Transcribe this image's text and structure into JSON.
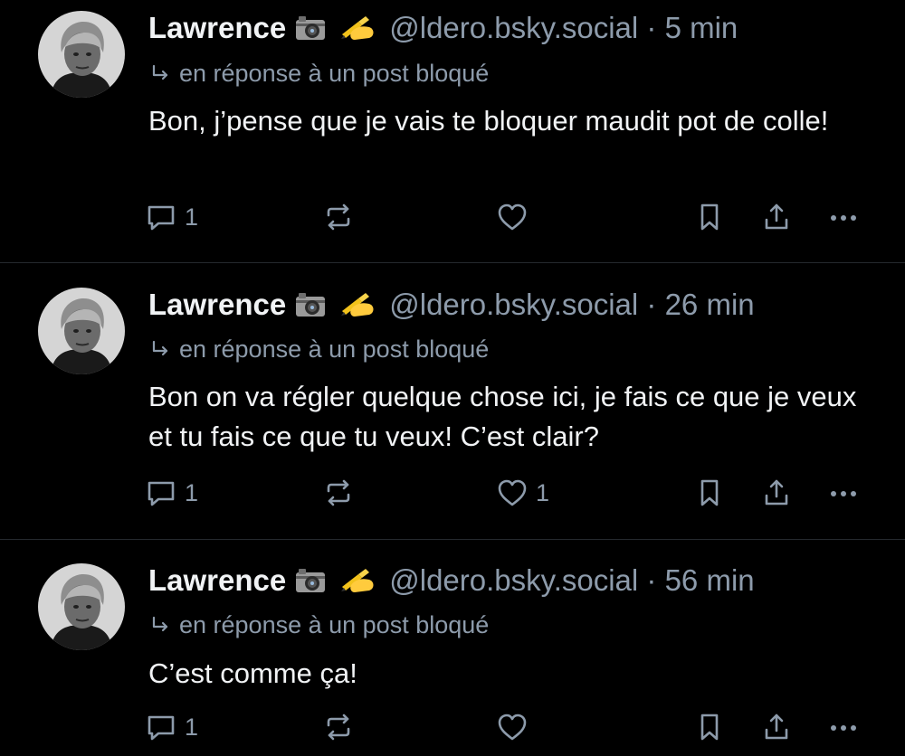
{
  "colors": {
    "background": "#000000",
    "text": "#f1f3f5",
    "muted": "#8d9bab",
    "divider": "#25292e"
  },
  "posts": [
    {
      "author": "Lawrence",
      "handle": "@ldero.bsky.social",
      "time": "5 min",
      "reply_note": "en réponse à un post bloqué",
      "text": "Bon, j’pense que je vais te bloquer maudit pot de colle!",
      "reply_count": "1",
      "like_count": ""
    },
    {
      "author": "Lawrence",
      "handle": "@ldero.bsky.social",
      "time": "26 min",
      "reply_note": "en réponse à un post bloqué",
      "text": "Bon on va régler quelque chose ici, je fais ce que je veux et tu fais ce que tu veux! C’est clair?",
      "reply_count": "1",
      "like_count": "1"
    },
    {
      "author": "Lawrence",
      "handle": "@ldero.bsky.social",
      "time": "56 min",
      "reply_note": "en réponse à un post bloqué",
      "text": "C’est comme ça!",
      "reply_count": "1",
      "like_count": ""
    }
  ],
  "separator": " · ",
  "icons": {
    "author_badges": [
      "camera-emoji",
      "writing-hand-emoji"
    ],
    "reply_note": "reply-arrow-icon",
    "actions": [
      "reply-icon",
      "repost-icon",
      "like-icon",
      "bookmark-icon",
      "share-icon",
      "more-icon"
    ]
  }
}
